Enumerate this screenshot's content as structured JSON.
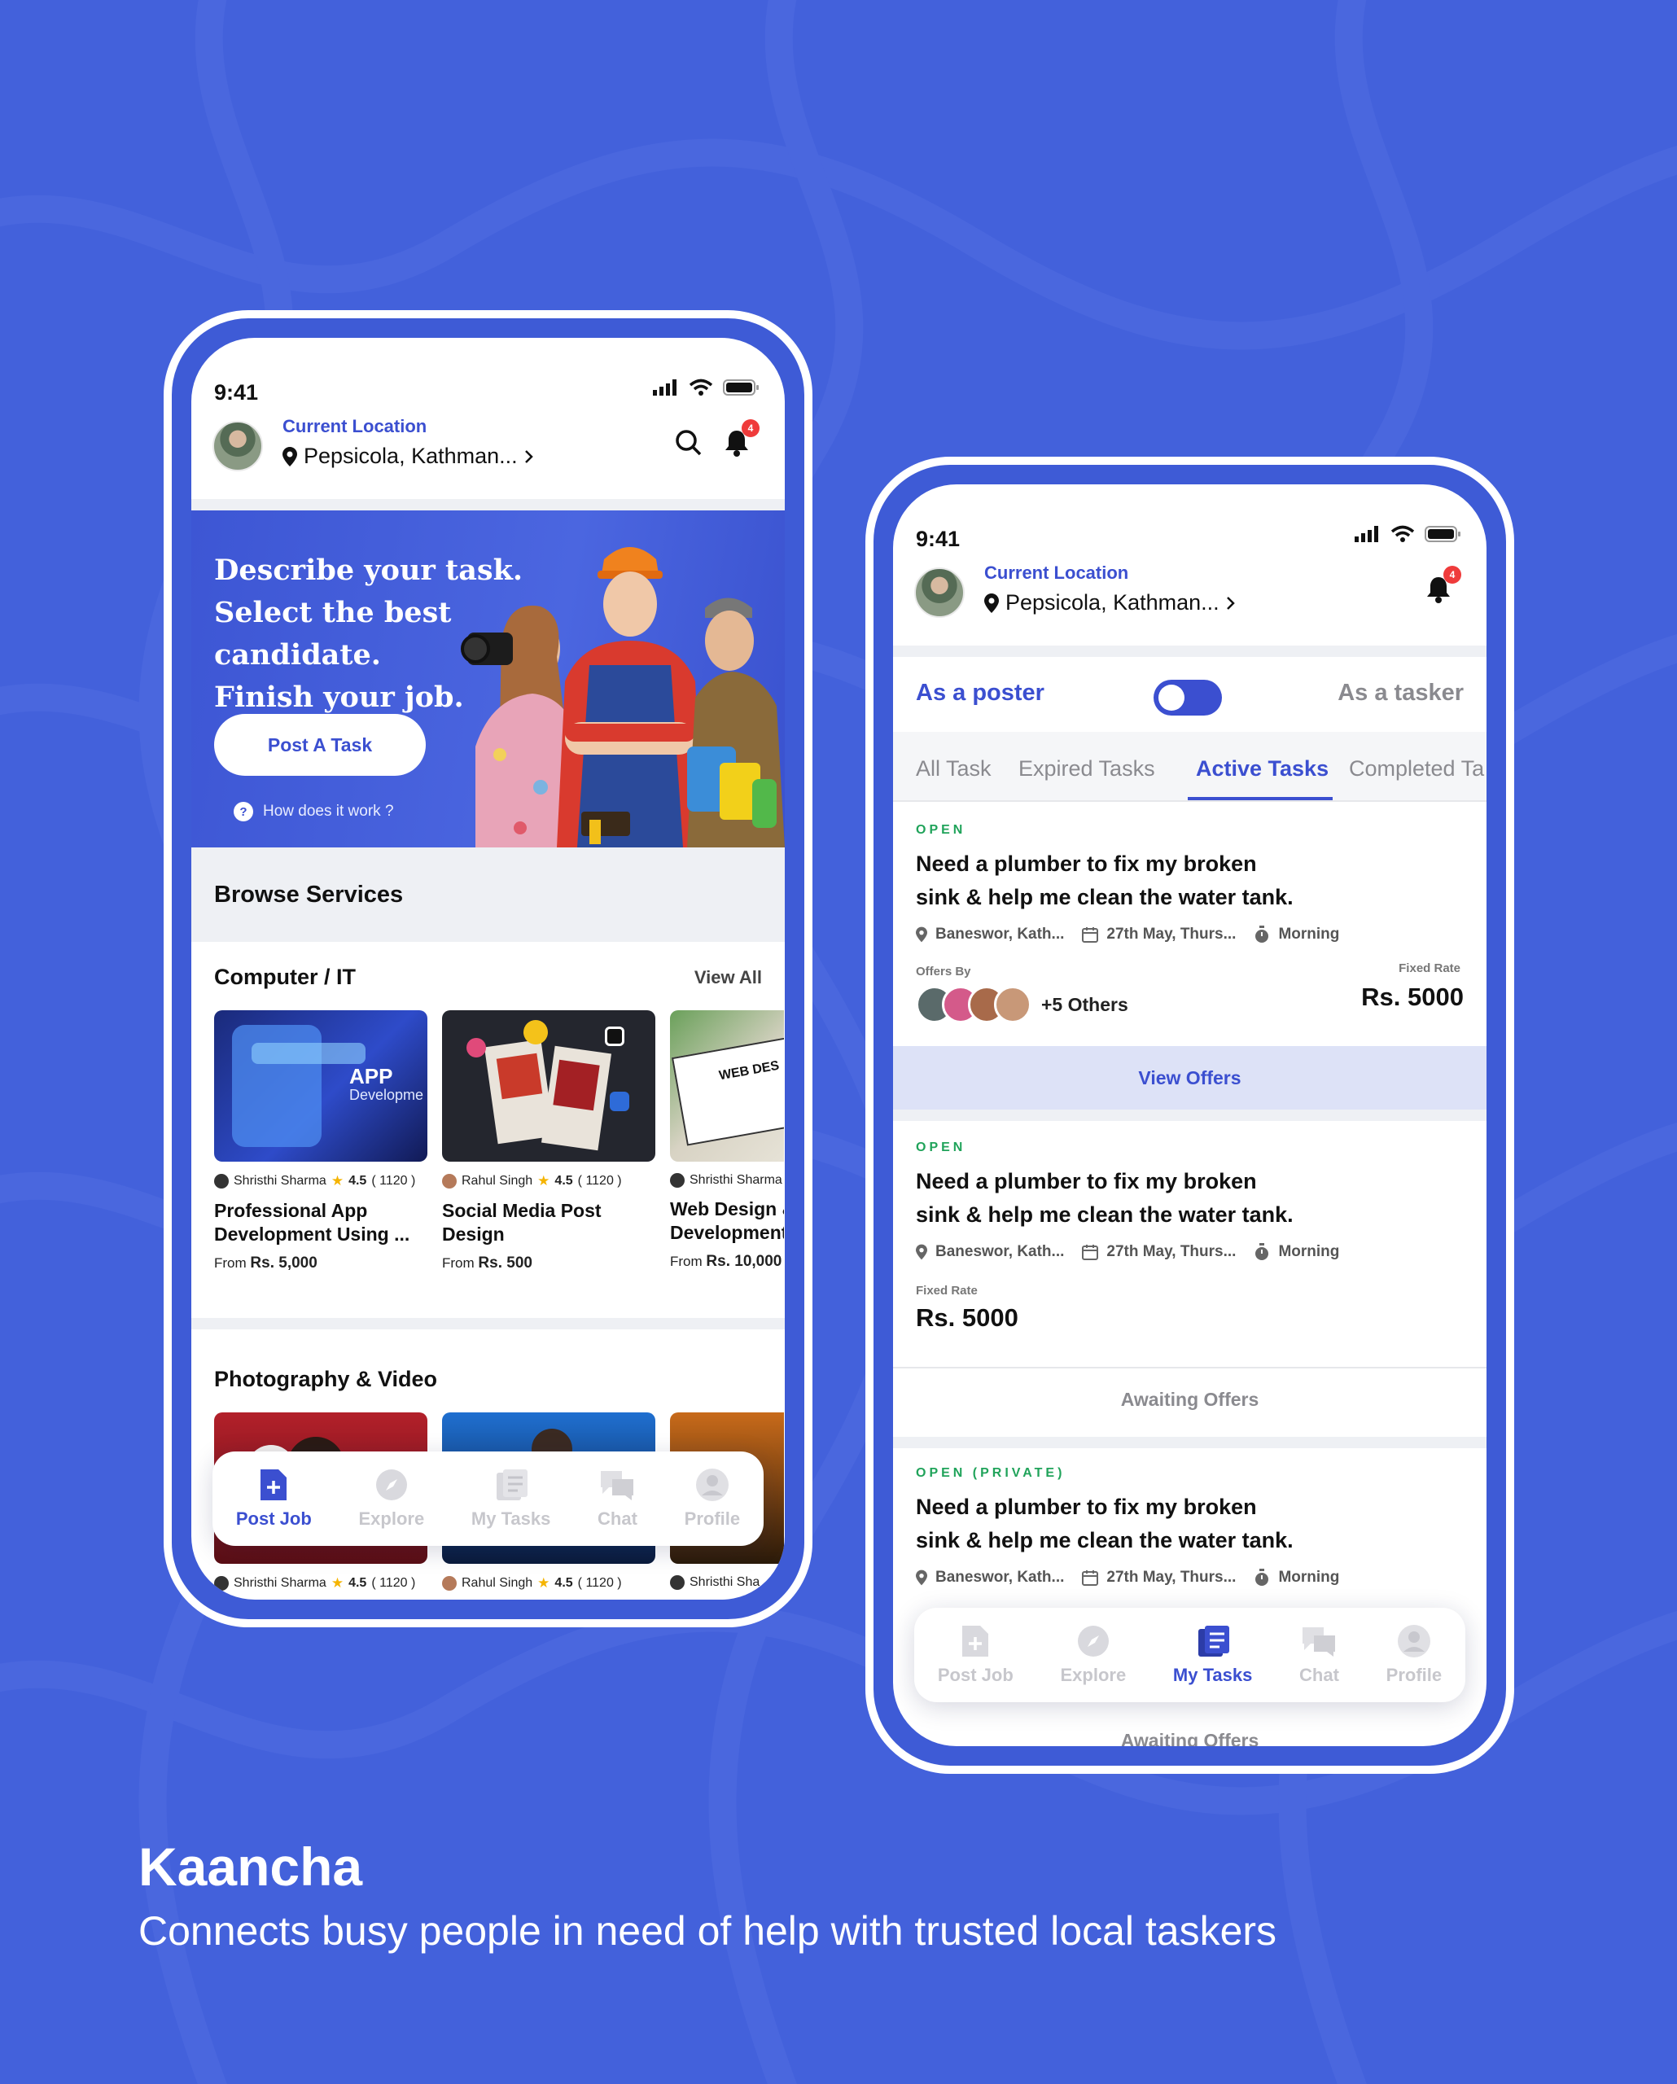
{
  "colors": {
    "background": "#4361db",
    "accent": "#3b4fd0",
    "open_status": "#20a35a",
    "badge": "#ef3b3b"
  },
  "brand": {
    "name": "Kaancha",
    "tagline": "Connects busy people in need of help with trusted local taskers"
  },
  "status_bar": {
    "time": "9:41"
  },
  "header": {
    "location_label": "Current Location",
    "location_value": "Pepsicola, Kathman...",
    "notification_count": "4"
  },
  "phone1": {
    "hero": {
      "line1": "Describe your task.",
      "line2": "Select the best candidate.",
      "line3": "Finish your job.",
      "cta": "Post A Task",
      "help": "How does it work ?"
    },
    "browse_title": "Browse Services",
    "sections": [
      {
        "title": "Computer / IT",
        "view_all": "View All",
        "cards": [
          {
            "provider": "Shristhi Sharma",
            "rating": "4.5",
            "reviews": "( 1120 )",
            "title": "Professional App Development Using ...",
            "price_prefix": "From",
            "price": "Rs. 5,000",
            "image_text": "APP",
            "image_subtext": "Developme"
          },
          {
            "provider": "Rahul Singh",
            "rating": "4.5",
            "reviews": "( 1120 )",
            "title": "Social Media Post Design",
            "price_prefix": "From",
            "price": "Rs. 500"
          },
          {
            "provider": "Shristhi Sharma",
            "title": "Web Design & Development",
            "price_prefix": "From",
            "price": "Rs. 10,000",
            "image_text": "WEB DES"
          }
        ]
      },
      {
        "title": "Photography & Video",
        "cards": [
          {
            "provider": "Shristhi Sharma",
            "rating": "4.5",
            "reviews": "( 1120 )"
          },
          {
            "provider": "Rahul Singh",
            "rating": "4.5",
            "reviews": "( 1120 )"
          },
          {
            "provider": "Shristhi Sha"
          }
        ]
      }
    ]
  },
  "nav": [
    {
      "label": "Post Job",
      "icon": "post-job-icon"
    },
    {
      "label": "Explore",
      "icon": "compass-icon"
    },
    {
      "label": "My Tasks",
      "icon": "tasks-icon"
    },
    {
      "label": "Chat",
      "icon": "chat-icon"
    },
    {
      "label": "Profile",
      "icon": "profile-icon"
    }
  ],
  "phone2": {
    "role_left": "As a poster",
    "role_right": "As a tasker",
    "tabs": [
      "All Task",
      "Expired Tasks",
      "Active Tasks",
      "Completed Ta"
    ],
    "active_tab": "Active Tasks",
    "tasks": [
      {
        "status": "OPEN",
        "title_line1": "Need a plumber to fix my broken",
        "title_line2": "sink & help me clean the water tank.",
        "location": "Baneswor, Kath...",
        "date": "27th May, Thurs...",
        "time": "Morning",
        "offers_label": "Offers By",
        "others": "+5 Others",
        "rate_label": "Fixed Rate",
        "rate": "Rs. 5000",
        "action": "View Offers"
      },
      {
        "status": "OPEN",
        "title_line1": "Need a plumber to fix my broken",
        "title_line2": "sink & help me clean the water tank.",
        "location": "Baneswor, Kath...",
        "date": "27th May, Thurs...",
        "time": "Morning",
        "rate_label": "Fixed Rate",
        "rate": "Rs. 5000",
        "action": "Awaiting Offers"
      },
      {
        "status": "OPEN (PRIVATE)",
        "title_line1": "Need a plumber to fix my broken",
        "title_line2": "sink & help me clean the water tank.",
        "location": "Baneswor, Kath...",
        "date": "27th May, Thurs...",
        "time": "Morning",
        "action": "Awaiting Offers"
      }
    ]
  }
}
